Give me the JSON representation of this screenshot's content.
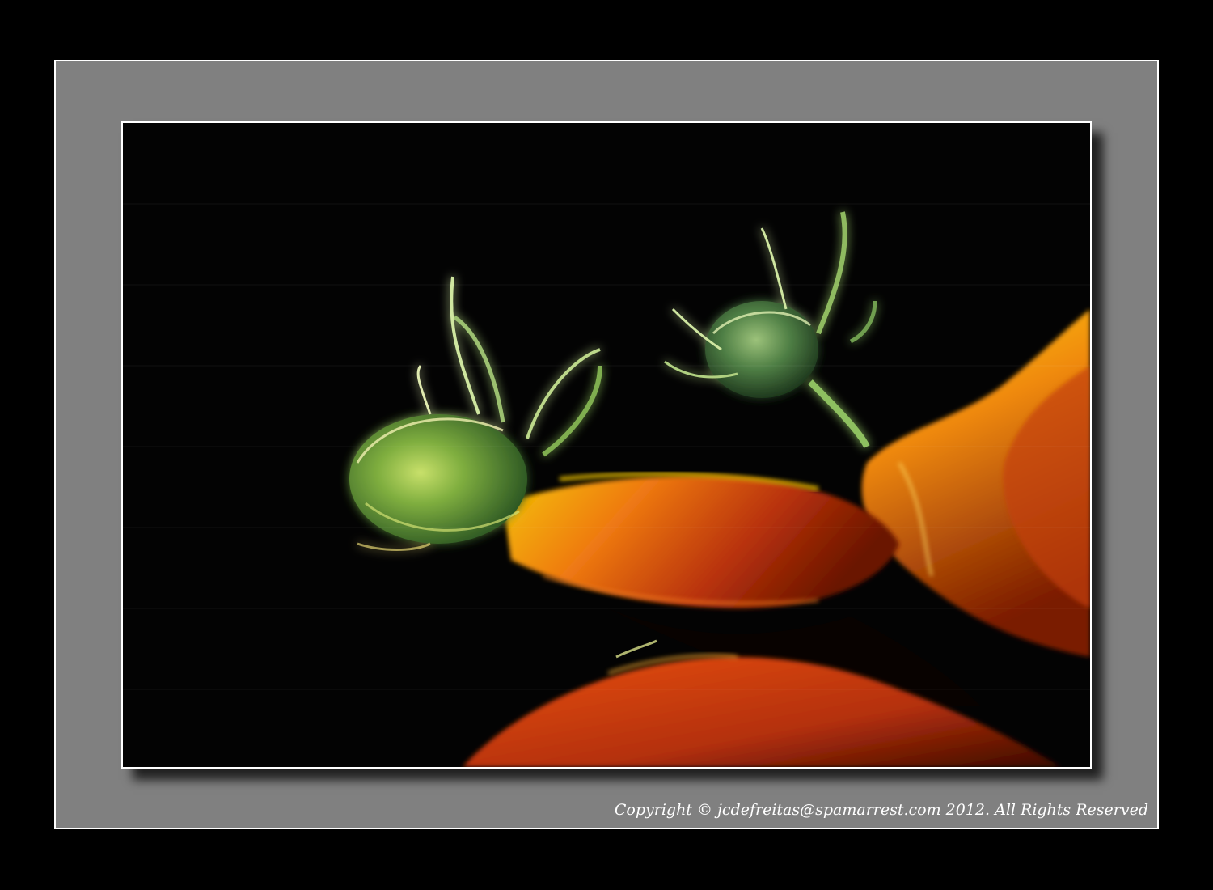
{
  "image": {
    "subject": "sunflower-buds-painting",
    "colors": {
      "background": "#000000",
      "mat": "#808080",
      "border": "#ffffff",
      "stem_orange": "#d9480f",
      "stem_yellow": "#f2c200",
      "bud_green": "#5f8f3a"
    }
  },
  "caption": {
    "copyright": "Copyright © jcdefreitas@spamarrest.com 2012. All Rights Reserved"
  }
}
